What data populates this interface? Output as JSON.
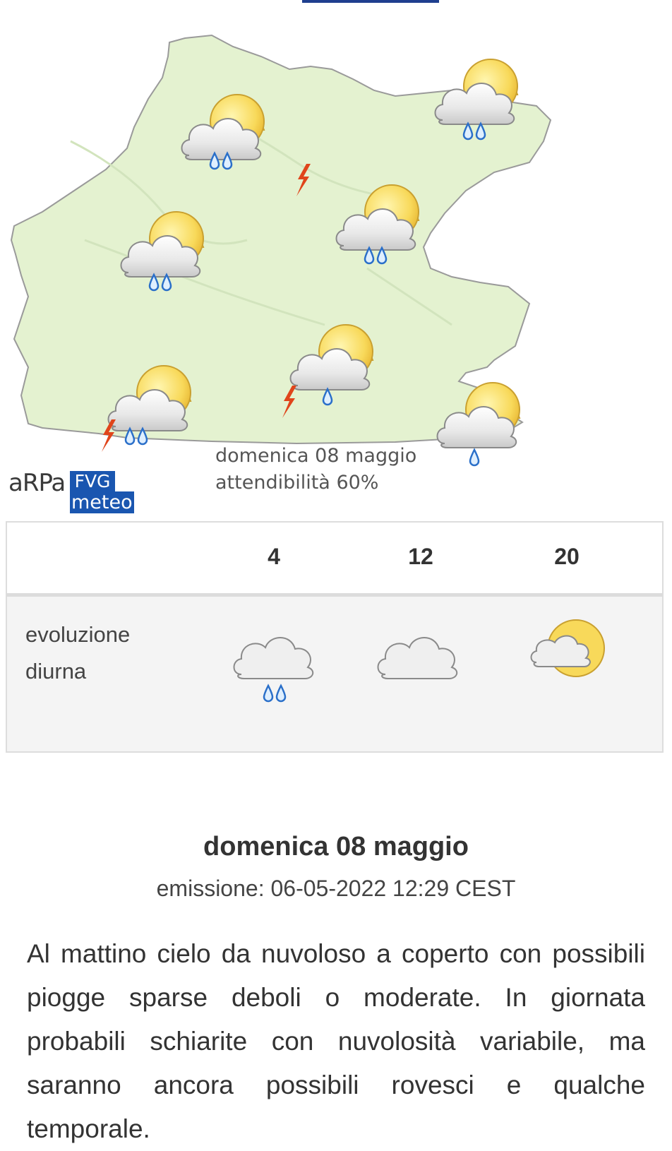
{
  "map": {
    "caption_day": "domenica 08 maggio",
    "caption_reliability": "attendibilità 60%",
    "logo": {
      "arpa": "aRPa",
      "fvg": "FVG",
      "meteo": "meteo"
    },
    "symbols": [
      "sun-cloud-rain-icon",
      "sun-cloud-rain-icon",
      "lightning-icon",
      "sun-cloud-rain-icon",
      "sun-cloud-rain-icon",
      "sun-cloud-light-rain-icon",
      "sun-cloud-rain-icon",
      "sun-cloud-light-rain-icon"
    ],
    "colors": {
      "land": "#e4f2d0",
      "border": "#9a9a9a",
      "cloud": "#e9e9e9",
      "sun": "#f7d35a",
      "rain": "#2a6fc9",
      "lightning": "#e0451b"
    }
  },
  "evolution": {
    "hours": [
      "4",
      "12",
      "20"
    ],
    "label_line1": "evoluzione",
    "label_line2": "diurna",
    "icons": [
      "cloud-rain-icon",
      "cloud-icon",
      "sun-cloud-icon"
    ]
  },
  "forecast": {
    "title": "domenica 08 maggio",
    "emission": "emissione: 06-05-2022 12:29 CEST",
    "text": "Al mattino cielo da nuvoloso a coperto con possibili piogge sparse deboli o moderate. In giornata probabili schiarite con nuvolosità variabile, ma saranno ancora possibili rovesci e qualche temporale."
  }
}
